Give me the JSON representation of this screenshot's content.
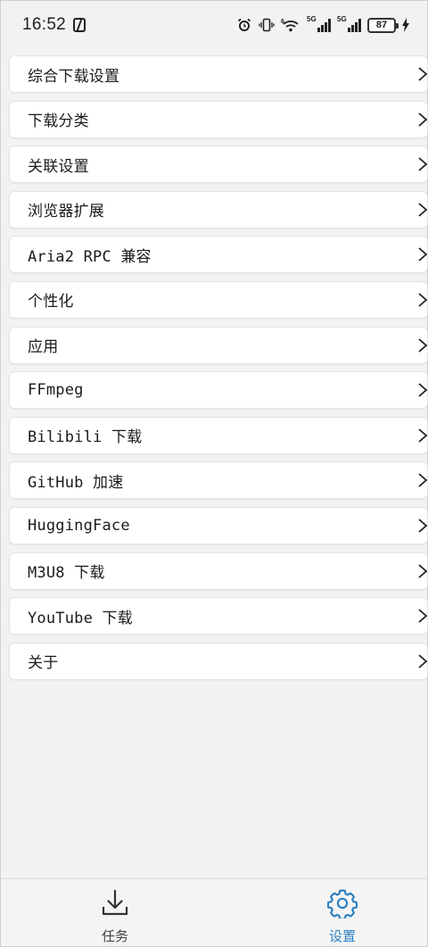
{
  "status_bar": {
    "time": "16:52",
    "battery": "87",
    "signal_1_tag": "5G",
    "signal_2_tag": "5G",
    "wifi_tag": "6"
  },
  "settings": {
    "items": [
      {
        "label": "综合下载设置"
      },
      {
        "label": "下载分类"
      },
      {
        "label": "关联设置"
      },
      {
        "label": "浏览器扩展"
      },
      {
        "label": "Aria2 RPC 兼容"
      },
      {
        "label": "个性化"
      },
      {
        "label": "应用"
      },
      {
        "label": "FFmpeg"
      },
      {
        "label": "Bilibili 下载"
      },
      {
        "label": "GitHub 加速"
      },
      {
        "label": "HuggingFace"
      },
      {
        "label": "M3U8 下载"
      },
      {
        "label": "YouTube 下载"
      },
      {
        "label": "关于"
      }
    ]
  },
  "bottom_nav": {
    "tasks_label": "任务",
    "settings_label": "设置",
    "active_color": "#2a7fc1",
    "inactive_color": "#444444"
  }
}
